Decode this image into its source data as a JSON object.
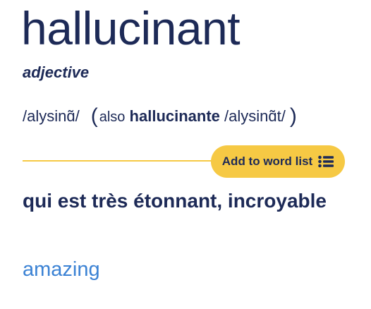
{
  "entry": {
    "headword": "hallucinant",
    "part_of_speech": "adjective",
    "pronunciation": "/alysinɑ̃/",
    "variant": {
      "also_label": "also",
      "word": "hallucinante",
      "pronunciation": "/alysinɑ̃t/"
    },
    "definition": "qui est très étonnant, incroyable",
    "translation": "amazing"
  },
  "actions": {
    "add_to_word_list_label": "Add to word list",
    "add_to_word_list_icon": "list-icon"
  },
  "colors": {
    "text": "#1d2a57",
    "accent": "#f6c944",
    "link": "#3b82d4"
  }
}
